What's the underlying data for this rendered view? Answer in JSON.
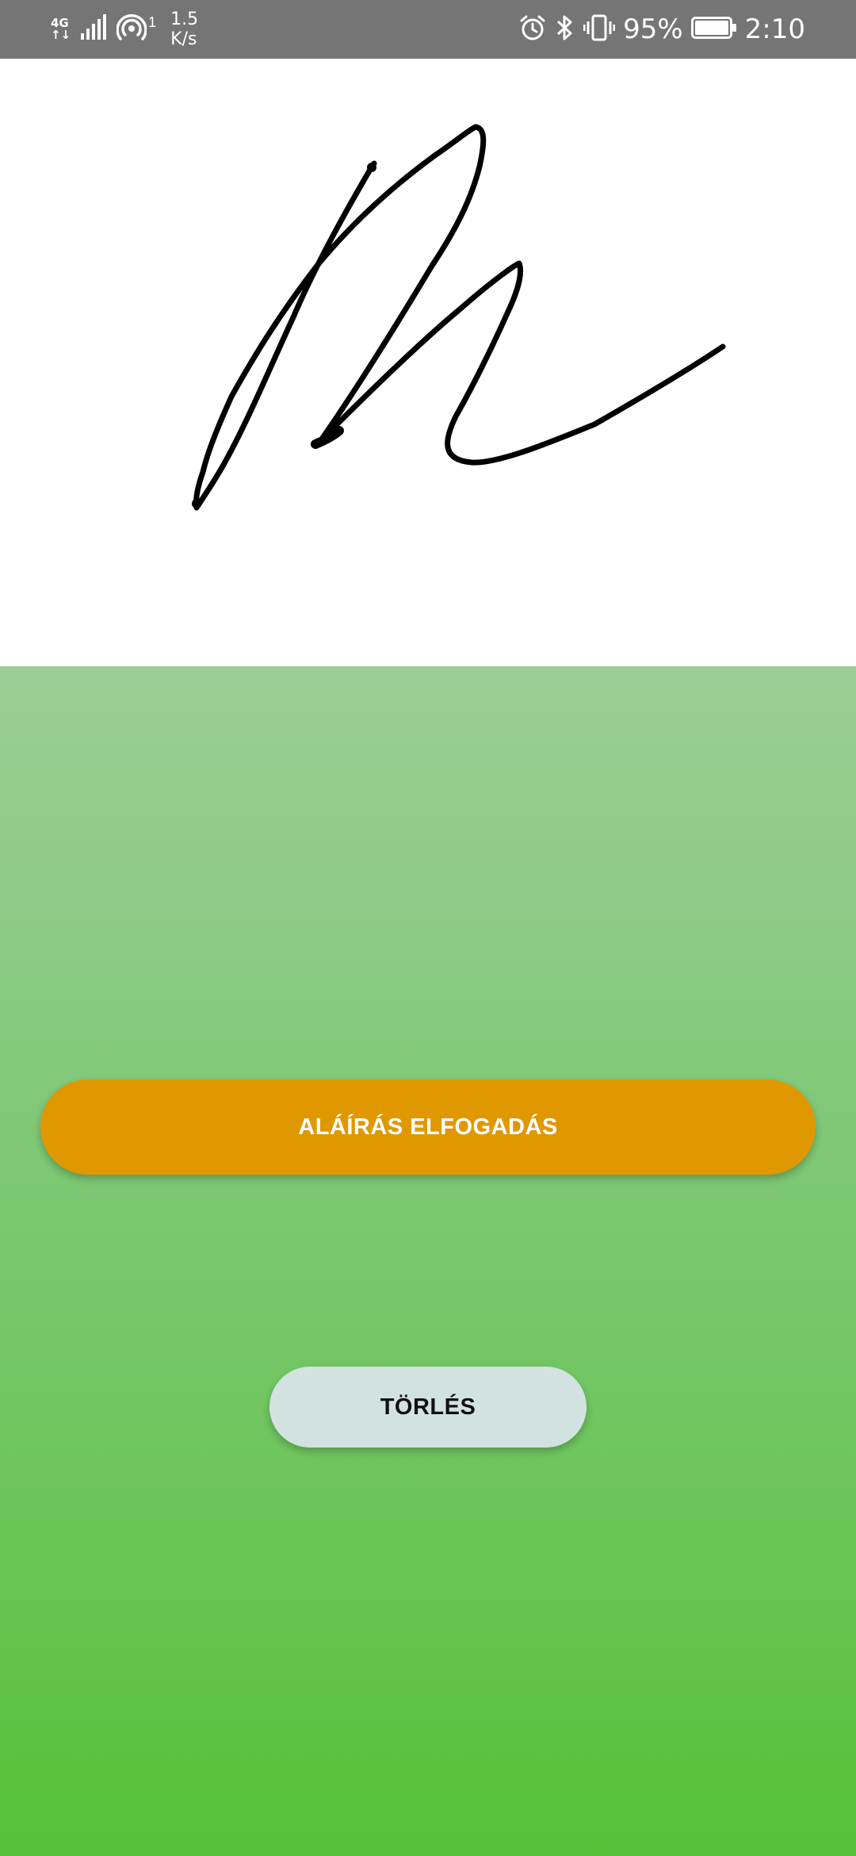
{
  "status_bar": {
    "network_type_top": "4G",
    "network_type_bottom": "↑↓",
    "hotspot_count": "1",
    "speed_value": "1.5",
    "speed_unit": "K/s",
    "battery_percent": "95%",
    "time": "2:10",
    "icons": [
      "signal-icon",
      "hotspot-icon",
      "alarm-icon",
      "bluetooth-icon",
      "vibrate-icon",
      "battery-icon"
    ]
  },
  "signature_pad": {
    "has_signature": true,
    "stroke_color": "#000000"
  },
  "actions": {
    "accept_label": "ALÁÍRÁS ELFOGADÁS",
    "clear_label": "TÖRLÉS"
  },
  "colors": {
    "status_bar": "#757575",
    "accept_button": "#e09800",
    "clear_button": "#d2e2e1",
    "panel_top": "#9ccd96",
    "panel_bottom": "#55c137"
  }
}
